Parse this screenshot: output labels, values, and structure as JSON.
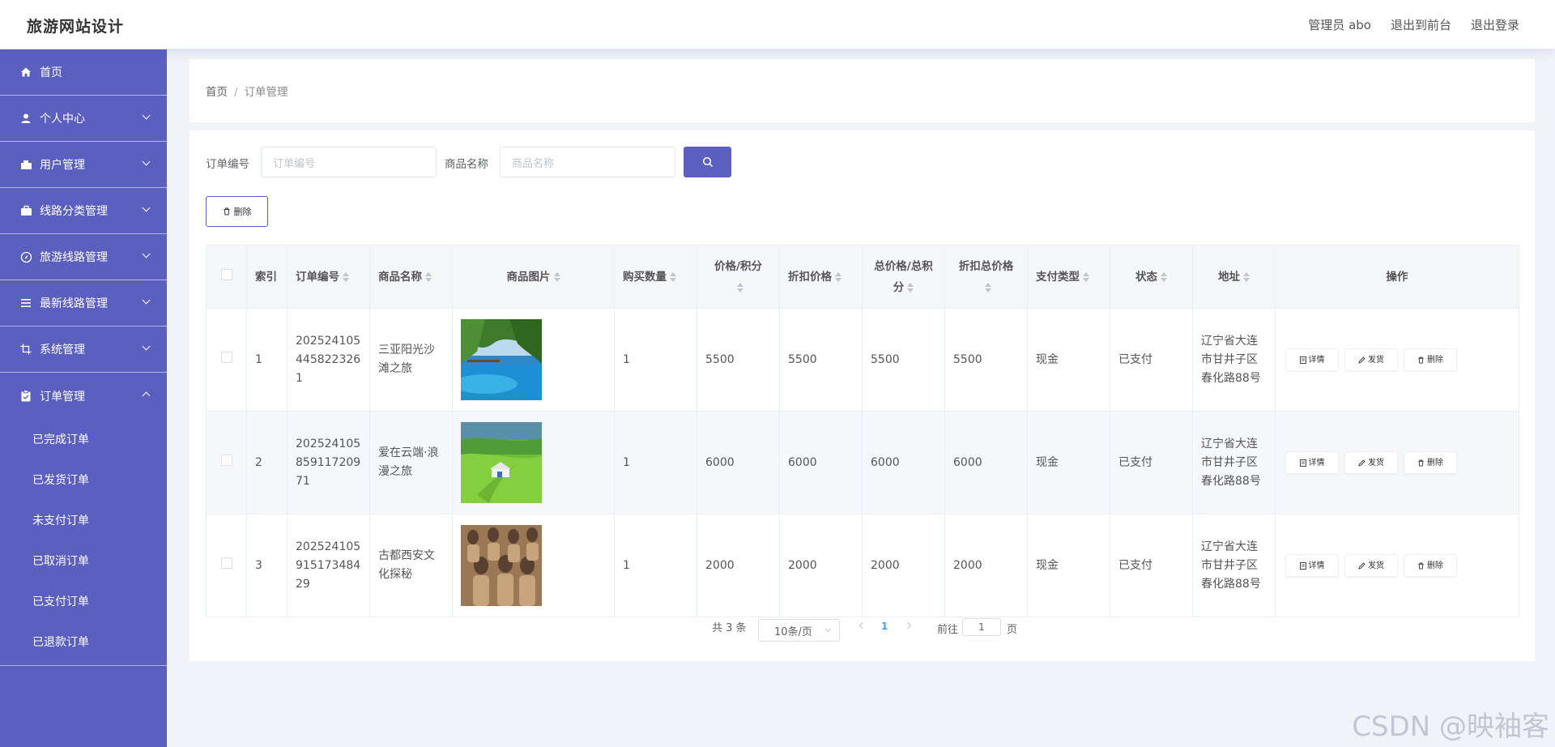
{
  "header": {
    "app_title": "旅游网站设计",
    "admin_label": "管理员 abo",
    "to_frontend": "退出到前台",
    "logout": "退出登录"
  },
  "sidebar": {
    "items": [
      {
        "label": "首页",
        "icon": "home-icon"
      },
      {
        "label": "个人中心",
        "icon": "user-icon"
      },
      {
        "label": "用户管理",
        "icon": "users-icon"
      },
      {
        "label": "线路分类管理",
        "icon": "briefcase-icon"
      },
      {
        "label": "旅游线路管理",
        "icon": "compass-icon"
      },
      {
        "label": "最新线路管理",
        "icon": "list-icon"
      },
      {
        "label": "系统管理",
        "icon": "crop-icon"
      },
      {
        "label": "订单管理",
        "icon": "clipboard-icon"
      }
    ],
    "submenu": [
      "已完成订单",
      "已发货订单",
      "未支付订单",
      "已取消订单",
      "已支付订单",
      "已退款订单"
    ]
  },
  "breadcrumb": {
    "home": "首页",
    "sep": "/",
    "current": "订单管理"
  },
  "filters": {
    "order_no_label": "订单编号",
    "order_no_placeholder": "订单编号",
    "product_label": "商品名称",
    "product_placeholder": "商品名称"
  },
  "delete_button": "删除",
  "table": {
    "headers": {
      "index": "索引",
      "order_no": "订单编号",
      "product": "商品名称",
      "image": "商品图片",
      "qty": "购买数量",
      "price": "价格/积分",
      "discount_price": "折扣价格",
      "total": "总价格/总积分",
      "discount_total": "折扣总价格",
      "pay_type": "支付类型",
      "status": "状态",
      "address": "地址",
      "ops": "操作"
    },
    "rows": [
      {
        "index": "1",
        "order_no": "2025241054458223261",
        "product": "三亚阳光沙滩之旅",
        "qty": "1",
        "price": "5500",
        "discount_price": "5500",
        "total": "5500",
        "discount_total": "5500",
        "pay_type": "现金",
        "status": "已支付",
        "address": "辽宁省大连市甘井子区春化路88号",
        "image": "beach"
      },
      {
        "index": "2",
        "order_no": "20252410585911720971",
        "product": "爱在云端·浪漫之旅",
        "qty": "1",
        "price": "6000",
        "discount_price": "6000",
        "total": "6000",
        "discount_total": "6000",
        "pay_type": "现金",
        "status": "已支付",
        "address": "辽宁省大连市甘井子区春化路88号",
        "image": "grassland"
      },
      {
        "index": "3",
        "order_no": "20252410591517348429",
        "product": "古都西安文化探秘",
        "qty": "1",
        "price": "2000",
        "discount_price": "2000",
        "total": "2000",
        "discount_total": "2000",
        "pay_type": "现金",
        "status": "已支付",
        "address": "辽宁省大连市甘井子区春化路88号",
        "image": "terracotta"
      }
    ],
    "ops": {
      "detail": "详情",
      "ship": "发货",
      "delete": "删除"
    }
  },
  "pagination": {
    "total": "共 3 条",
    "page_size": "10条/页",
    "current": "1",
    "goto": "前往",
    "goto_value": "1",
    "page_suffix": "页"
  },
  "watermark": "CSDN @映袖客",
  "colors": {
    "primary": "#5b5fbf",
    "link": "#409eff"
  }
}
